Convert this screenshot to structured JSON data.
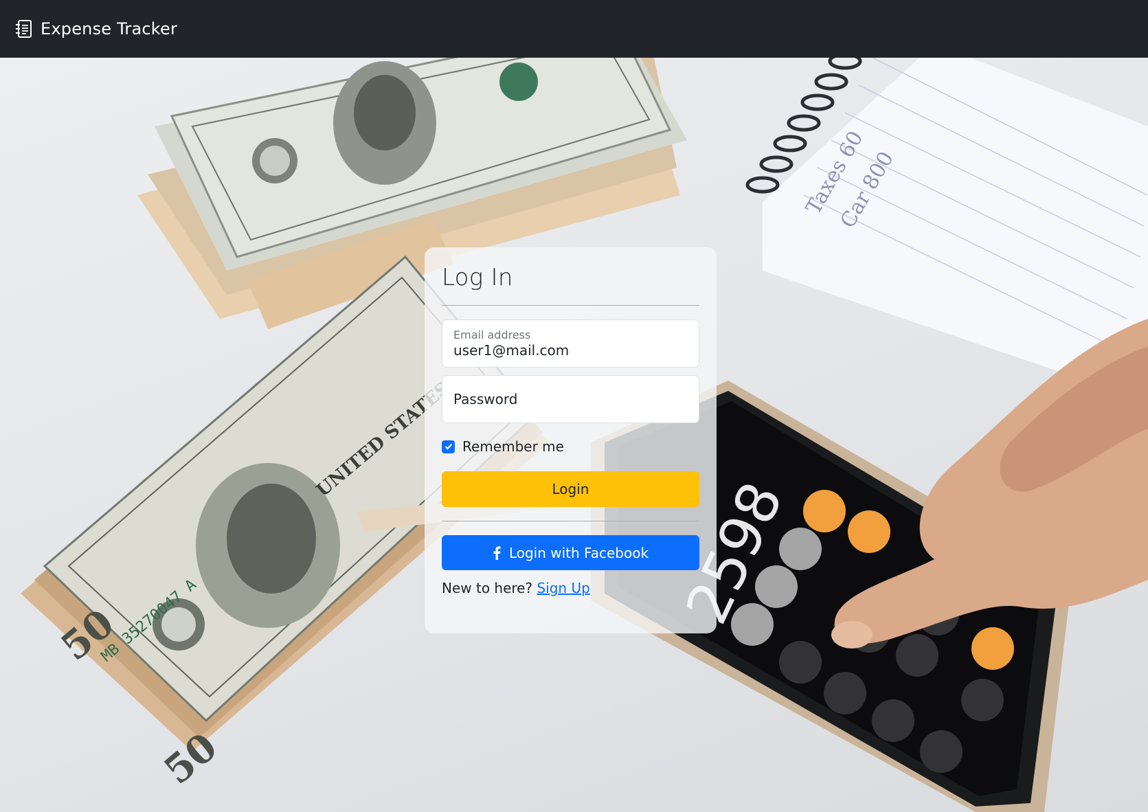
{
  "navbar": {
    "brand": "Expense Tracker",
    "brand_icon": "journal-text-icon",
    "background": "#212529"
  },
  "login_card": {
    "title": "Log In",
    "email": {
      "label": "Email address",
      "value": "user1@mail.com"
    },
    "password": {
      "placeholder": "Password"
    },
    "remember_me": {
      "label": "Remember me",
      "checked": true
    },
    "login_button": "Login",
    "facebook_button": "Login with Facebook",
    "facebook_icon": "facebook-f-icon",
    "signup_prompt": "New to here?",
    "signup_link": "Sign Up"
  },
  "colors": {
    "login_button": "#ffc107",
    "facebook_button": "#0d6efd",
    "link": "#0d6efd",
    "checkbox": "#0d6efd"
  },
  "background_scene": {
    "calculator_display": "2598",
    "notepad_text": "Taxes 60 / Car 800"
  }
}
